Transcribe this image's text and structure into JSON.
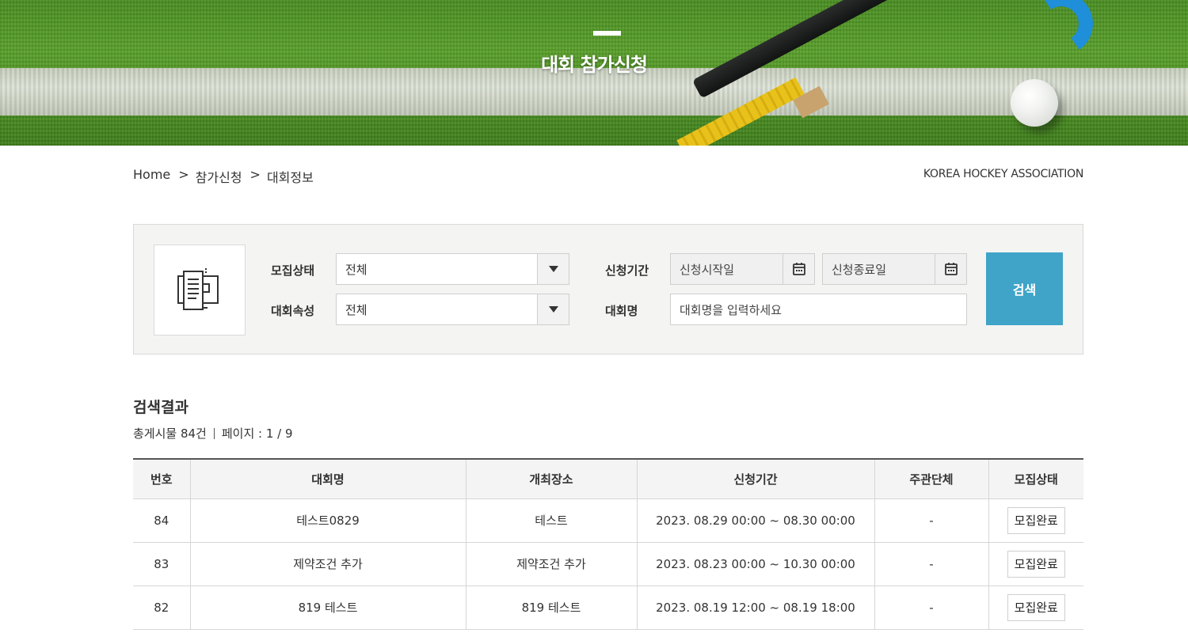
{
  "hero": {
    "title": "대회 참가신청"
  },
  "breadcrumb": {
    "home": "Home",
    "sep": ">",
    "level1": "참가신청",
    "level2": "대회정보"
  },
  "brand": "KOREA HOCKEY ASSOCIATION",
  "search": {
    "recruit_status_label": "모집상태",
    "recruit_status_value": "전체",
    "attribute_label": "대회속성",
    "attribute_value": "전체",
    "period_label": "신청기간",
    "start_placeholder": "신청시작일",
    "end_placeholder": "신청종료일",
    "name_label": "대회명",
    "name_placeholder": "대회명을 입력하세요",
    "button_label": "검색"
  },
  "results": {
    "title": "검색결과",
    "total": "총게시물 84건",
    "page": "페이지 : 1 / 9",
    "columns": [
      "번호",
      "대회명",
      "개최장소",
      "신청기간",
      "주관단체",
      "모집상태"
    ],
    "rows": [
      {
        "no": "84",
        "name": "테스트0829",
        "place": "테스트",
        "period": "2023. 08.29  00:00  ~  08.30  00:00",
        "org": "-",
        "status": "모집완료"
      },
      {
        "no": "83",
        "name": "제약조건 추가",
        "place": "제약조건 추가",
        "period": "2023. 08.23  00:00  ~  10.30  00:00",
        "org": "-",
        "status": "모집완료"
      },
      {
        "no": "82",
        "name": "819 테스트",
        "place": "819 테스트",
        "period": "2023. 08.19  12:00  ~  08.19  18:00",
        "org": "-",
        "status": "모집완료"
      }
    ]
  },
  "colors": {
    "accent": "#3fa4c8",
    "panel_bg": "#f4f4f3"
  },
  "icons": {
    "panel": "document-list-icon",
    "calendar": "calendar-icon",
    "dropdown": "triangle-down-icon"
  }
}
